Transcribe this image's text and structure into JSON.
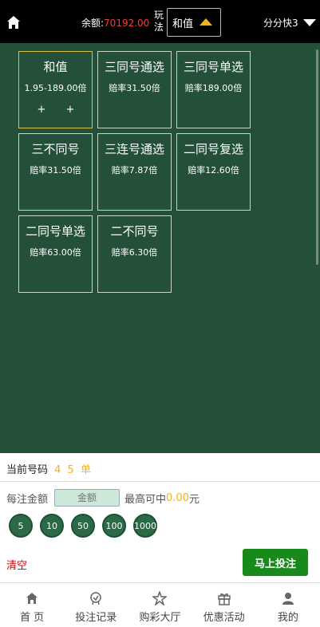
{
  "header": {
    "balance_label": "余额:",
    "balance_value": "70192.00",
    "play_label": "玩法",
    "play_selected": "和值",
    "game_name": "分分快3"
  },
  "cells": [
    {
      "name": "和值",
      "odds": "1.95-189.00倍",
      "plus_left": "+",
      "plus_right": "+",
      "active": true
    },
    {
      "name": "三同号通选",
      "odds": "赔率31.50倍"
    },
    {
      "name": "三同号单选",
      "odds": "赔率189.00倍"
    },
    {
      "name": "三不同号",
      "odds": "赔率31.50倍"
    },
    {
      "name": "三连号通选",
      "odds": "赔率7.87倍"
    },
    {
      "name": "二同号复选",
      "odds": "赔率12.60倍"
    },
    {
      "name": "二同号单选",
      "odds": "赔率63.00倍"
    },
    {
      "name": "二不同号",
      "odds": "赔率6.30倍"
    }
  ],
  "bet": {
    "current_label": "当前号码",
    "current_numbers": "4 5 单",
    "amount_label": "每注金额",
    "amount_placeholder": "金额",
    "max_label": "最高可中",
    "max_value": "0.00",
    "max_unit": "元",
    "chips": [
      "5",
      "10",
      "50",
      "100",
      "1000"
    ],
    "clear_label": "清空",
    "submit_label": "马上投注"
  },
  "nav": [
    {
      "label": "首 页",
      "icon": "home-icon"
    },
    {
      "label": "投注记录",
      "icon": "badge-icon"
    },
    {
      "label": "购彩大厅",
      "icon": "star-icon"
    },
    {
      "label": "优惠活动",
      "icon": "gift-icon"
    },
    {
      "label": "我的",
      "icon": "user-icon"
    }
  ]
}
